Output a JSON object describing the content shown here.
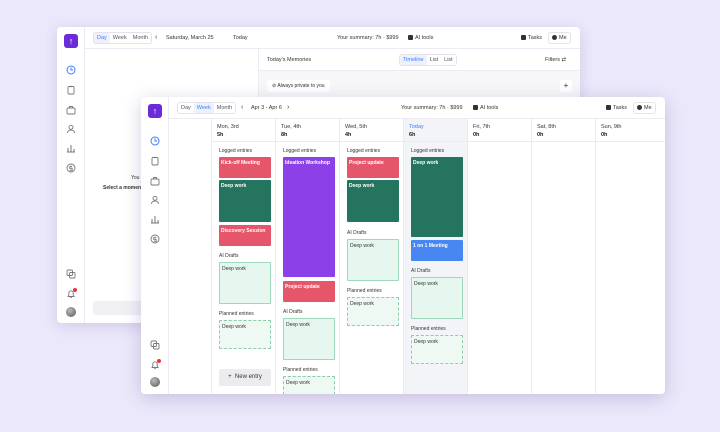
{
  "back_window": {
    "views": [
      "Day",
      "Week",
      "Month"
    ],
    "active_view": "Day",
    "date": "Saturday, March 25",
    "today_label": "Today",
    "summary": "Your summary: 7h · $999",
    "ai_tools": "AI tools",
    "tasks": "Tasks",
    "me": "Me",
    "memories_title": "Today's Memories",
    "memory_views": [
      "Timeline",
      "List",
      "List"
    ],
    "filters": "Filters",
    "private_note": "Always private to you",
    "empty_partial": "You",
    "select_partial": "Select a momen",
    "plus": "+"
  },
  "front_window": {
    "views": [
      "Day",
      "Week",
      "Month"
    ],
    "active_view": "Week",
    "date_range": "Apr 3 - Apr 6",
    "summary": "Your summary: 7h · $999",
    "ai_tools": "AI tools",
    "tasks": "Tasks",
    "me": "Me",
    "days": [
      {
        "name": "Mon, 3rd",
        "hours": "5h"
      },
      {
        "name": "Tue, 4th",
        "hours": "8h"
      },
      {
        "name": "Wed, 5th",
        "hours": "4h"
      },
      {
        "name": "Today",
        "hours": "6h"
      },
      {
        "name": "Fri, 7th",
        "hours": "0h"
      },
      {
        "name": "Sat, 8th",
        "hours": "0h"
      },
      {
        "name": "Sun, 9th",
        "hours": "0h"
      }
    ],
    "labels": {
      "logged": "Logged entries",
      "ai_drafts": "AI Drafts",
      "planned": "Planned entries",
      "new_entry": "New entry"
    },
    "entries": {
      "mon": [
        "Kick-off Meeting",
        "Deep work",
        "Discovery Session"
      ],
      "tue": [
        "Ideation Workshop",
        "Project update"
      ],
      "wed": [
        "Project update",
        "Deep work"
      ],
      "thu": [
        "Deep work",
        "1 on 1 Meeting"
      ]
    },
    "drafts": {
      "mon": "Deep work",
      "tue": "Deep work",
      "wed": "Deep work",
      "thu": "Deep work"
    },
    "planned": {
      "mon": "Deep work",
      "tue": "Deep work",
      "wed": "Deep work",
      "thu": "Deep work"
    }
  },
  "colors": {
    "brand": "#6c2bd9",
    "accent": "#3d7cff",
    "entry_red": "#e5566a",
    "entry_green": "#25745f",
    "entry_purple": "#8c40e8",
    "entry_blue": "#4887f2",
    "draft_green": "#e6f7ef"
  }
}
